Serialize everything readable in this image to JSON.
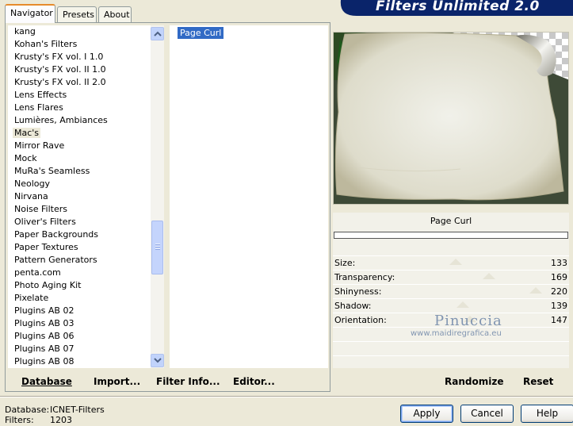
{
  "tabs": [
    {
      "label": "Navigator"
    },
    {
      "label": "Presets"
    },
    {
      "label": "About"
    }
  ],
  "banner": {
    "title": "Filters Unlimited 2.0"
  },
  "categories": [
    "kang",
    "Kohan's Filters",
    "Krusty's FX vol. I 1.0",
    "Krusty's FX vol. II 1.0",
    "Krusty's FX vol. II 2.0",
    "Lens Effects",
    "Lens Flares",
    "Lumières, Ambiances",
    "Mac's",
    "Mirror Rave",
    "Mock",
    "MuRa's Seamless",
    "Neology",
    "Nirvana",
    "Noise Filters",
    "Oliver's Filters",
    "Paper Backgrounds",
    "Paper Textures",
    "Pattern Generators",
    "penta.com",
    "Photo Aging Kit",
    "Pixelate",
    "Plugins AB 02",
    "Plugins AB 03",
    "Plugins AB 06",
    "Plugins AB 07",
    "Plugins AB 08"
  ],
  "selected_category": "Mac's",
  "filters": [
    "Page Curl"
  ],
  "left_buttons": {
    "database": "Database",
    "import": "Import...",
    "filter_info": "Filter Info...",
    "editor": "Editor..."
  },
  "filter_name": "Page Curl",
  "progress": 0,
  "params": [
    {
      "label": "Size:",
      "value": "133",
      "level": 0.52
    },
    {
      "label": "Transparency:",
      "value": "169",
      "level": 0.66
    },
    {
      "label": "Shinyness:",
      "value": "220",
      "level": 0.86
    },
    {
      "label": "Shadow:",
      "value": "139",
      "level": 0.55
    },
    {
      "label": "Orientation:",
      "value": "147",
      "level": 0.58
    }
  ],
  "watermark": {
    "name": "Pinuccia",
    "url": "www.maidiregrafica.eu"
  },
  "right_buttons": {
    "randomize": "Randomize",
    "reset": "Reset"
  },
  "status": {
    "db_label": "Database:",
    "db_value": "ICNET-Filters",
    "filters_label": "Filters:",
    "filters_value": "1203"
  },
  "dialog_buttons": {
    "apply": "Apply",
    "cancel": "Cancel",
    "help": "Help"
  },
  "colors": {
    "banner": "#0a246a",
    "selection": "#316ac5",
    "tab_accent": "#e68b2c"
  }
}
